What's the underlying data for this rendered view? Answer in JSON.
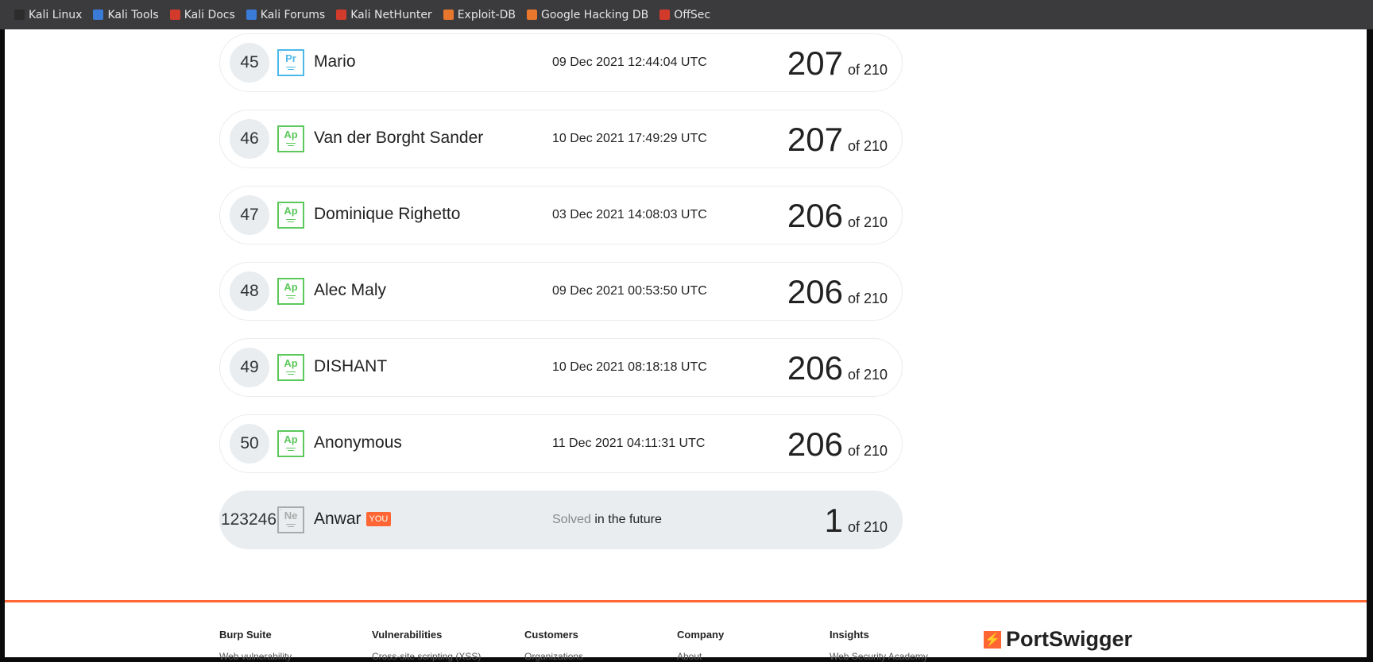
{
  "bookmarks": [
    {
      "label": "Kali Linux",
      "icon": "kali-dragon-icon",
      "color": "#2c2c2c"
    },
    {
      "label": "Kali Tools",
      "icon": "kali-tools-icon",
      "color": "#3b7bd8"
    },
    {
      "label": "Kali Docs",
      "icon": "kali-docs-icon",
      "color": "#d23b2b"
    },
    {
      "label": "Kali Forums",
      "icon": "kali-forums-icon",
      "color": "#3b7bd8"
    },
    {
      "label": "Kali NetHunter",
      "icon": "kali-nethunter-icon",
      "color": "#d23b2b"
    },
    {
      "label": "Exploit-DB",
      "icon": "exploit-db-icon",
      "color": "#e8762c"
    },
    {
      "label": "Google Hacking DB",
      "icon": "ghdb-icon",
      "color": "#e8762c"
    },
    {
      "label": "OffSec",
      "icon": "offsec-icon",
      "color": "#d23b2b"
    }
  ],
  "leaderboard": [
    {
      "rank": "45",
      "badge": "Pr",
      "badge_color": "#4cb8e8",
      "name": "Mario",
      "date": "09 Dec 2021 12:44:04 UTC",
      "score": "207",
      "of": "of 210"
    },
    {
      "rank": "46",
      "badge": "Ap",
      "badge_color": "#5bc85b",
      "name": "Van der Borght Sander",
      "date": "10 Dec 2021 17:49:29 UTC",
      "score": "207",
      "of": "of 210"
    },
    {
      "rank": "47",
      "badge": "Ap",
      "badge_color": "#5bc85b",
      "name": "Dominique Righetto",
      "date": "03 Dec 2021 14:08:03 UTC",
      "score": "206",
      "of": "of 210"
    },
    {
      "rank": "48",
      "badge": "Ap",
      "badge_color": "#5bc85b",
      "name": "Alec Maly",
      "date": "09 Dec 2021 00:53:50 UTC",
      "score": "206",
      "of": "of 210"
    },
    {
      "rank": "49",
      "badge": "Ap",
      "badge_color": "#5bc85b",
      "name": "DISHANT",
      "date": "10 Dec 2021 08:18:18 UTC",
      "score": "206",
      "of": "of 210"
    },
    {
      "rank": "50",
      "badge": "Ap",
      "badge_color": "#5bc85b",
      "name": "Anonymous",
      "date": "11 Dec 2021 04:11:31 UTC",
      "score": "206",
      "of": "of 210"
    }
  ],
  "you_row": {
    "rank": "123246",
    "badge": "Ne",
    "badge_color": "#aaaaaa",
    "name": "Anwar",
    "you_tag": "YOU",
    "date_muted": "Solved",
    "date_rest": " in the future",
    "score": "1",
    "of": "of 210"
  },
  "footer": {
    "accent": "#ff6633",
    "columns": [
      {
        "title": "Burp Suite",
        "sub": "Web vulnerability"
      },
      {
        "title": "Vulnerabilities",
        "sub": "Cross-site scripting (XSS)"
      },
      {
        "title": "Customers",
        "sub": "Organizations"
      },
      {
        "title": "Company",
        "sub": "About"
      },
      {
        "title": "Insights",
        "sub": "Web Security Academy"
      }
    ],
    "logo": "PortSwigger"
  }
}
